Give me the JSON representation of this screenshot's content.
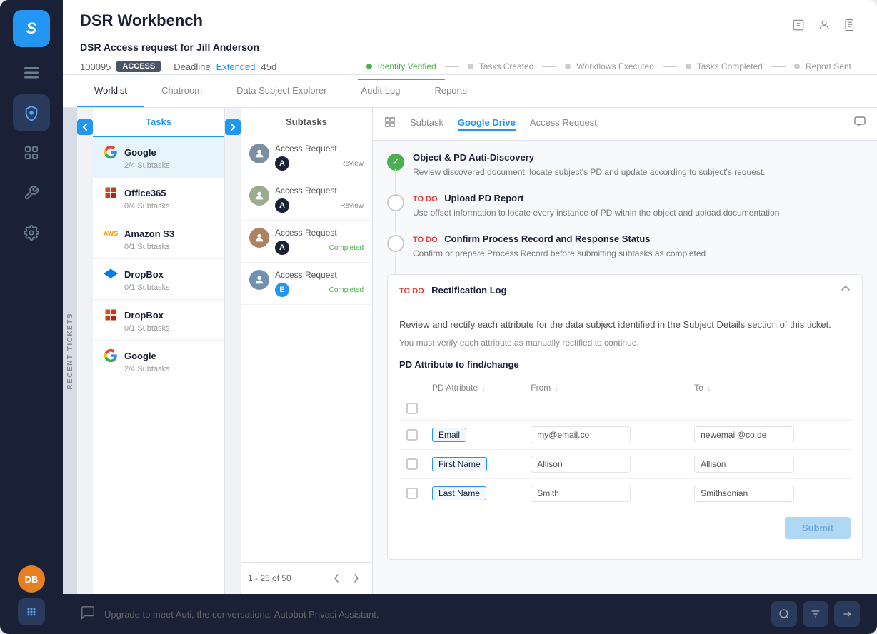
{
  "app": {
    "logo": "securiti",
    "page_title": "DSR Workbench"
  },
  "sidebar": {
    "nav_items": [
      {
        "id": "menu",
        "icon": "≡"
      },
      {
        "id": "shield",
        "icon": "⬡",
        "active": true
      },
      {
        "id": "dashboard",
        "icon": "⊞"
      },
      {
        "id": "wrench",
        "icon": "⚙"
      },
      {
        "id": "gear",
        "icon": "✦"
      }
    ],
    "avatar": "DB",
    "dots": "⋯"
  },
  "dsr": {
    "title": "DSR Access request for Jill Anderson",
    "ticket_id": "100095",
    "access_badge": "ACCESS",
    "deadline_label": "Deadline",
    "extended_text": "Extended",
    "days": "45d"
  },
  "progress_tabs": [
    {
      "label": "Identity Verified",
      "active": true
    },
    {
      "label": "Tasks Created",
      "active": false
    },
    {
      "label": "Workflows Executed",
      "active": false
    },
    {
      "label": "Tasks Completed",
      "active": false
    },
    {
      "label": "Report Sent",
      "active": false
    }
  ],
  "main_tabs": [
    {
      "label": "Worklist",
      "active": true
    },
    {
      "label": "Chatroom",
      "active": false
    },
    {
      "label": "Data Subject Explorer",
      "active": false
    },
    {
      "label": "Audit Log",
      "active": false
    },
    {
      "label": "Reports",
      "active": false
    }
  ],
  "recent_tickets": "RECENT TICKETS",
  "tasks_panel": {
    "header": "Tasks",
    "items": [
      {
        "name": "Google",
        "sub": "2/4 Subtasks",
        "icon": "G",
        "color": "#ea4335",
        "active": true
      },
      {
        "name": "Office365",
        "sub": "0/4 Subtasks",
        "icon": "O",
        "color": "#d04e2b"
      },
      {
        "name": "Amazon S3",
        "sub": "0/1 Subtasks",
        "icon": "aws",
        "color": "#ff9900"
      },
      {
        "name": "DropBox",
        "sub": "0/1 Subtasks",
        "icon": "D",
        "color": "#007ee5"
      },
      {
        "name": "DropBox",
        "sub": "0/1 Subtasks",
        "icon": "D",
        "color": "#d04e2b"
      },
      {
        "name": "Google",
        "sub": "2/4 Subtasks",
        "icon": "G",
        "color": "#ea4335"
      }
    ]
  },
  "subtasks_panel": {
    "header": "Subtasks",
    "items": [
      {
        "title": "Access Request",
        "badge": "A",
        "status": "Review"
      },
      {
        "title": "Access Request",
        "badge": "A",
        "status": "Review"
      },
      {
        "title": "Access Request",
        "badge": "A",
        "status": "Completed"
      },
      {
        "title": "Access Request",
        "badge": "E",
        "status": "Completed"
      }
    ],
    "pagination": "1 - 25 of 50"
  },
  "subtask_tabs": [
    {
      "label": "Subtask",
      "active": false
    },
    {
      "label": "Google Drive",
      "active": true
    },
    {
      "label": "Access Request",
      "active": false
    }
  ],
  "task_steps": [
    {
      "done": true,
      "title": "Object & PD Auti-Discovery",
      "desc": "Review discovered document, locate subject's PD and update according to subject's request."
    },
    {
      "done": false,
      "todo": true,
      "title": "Upload PD Report",
      "desc": "Use offset information to locate every instance of PD within the object and upload documentation"
    },
    {
      "done": false,
      "todo": true,
      "title": "Confirm Process Record and Response Status",
      "desc": "Confirm or prepare Process Record before submitting subtasks as completed"
    }
  ],
  "rectification": {
    "todo_label": "TO DO",
    "title": "Rectification Log",
    "desc": "Review and rectify each attribute for the data subject identified in the Subject Details section of this ticket.",
    "note": "You must verify each attribute as manually rectified to continue.",
    "pd_section_title": "PD Attribute to find/change",
    "table_headers": [
      "PD Attribute",
      "From",
      "To"
    ],
    "rows": [
      {
        "attribute": "Email",
        "from": "my@email.co",
        "to": "newemail@co.de"
      },
      {
        "attribute": "First Name",
        "from": "Allison",
        "to": "Allison"
      },
      {
        "attribute": "Last Name",
        "from": "Smith",
        "to": "Smithsonian"
      }
    ],
    "submit_label": "Submit"
  },
  "bottom_bar": {
    "upgrade_text": "Upgrade to meet Auti, the conversational Autobot Privaci Assistant."
  }
}
